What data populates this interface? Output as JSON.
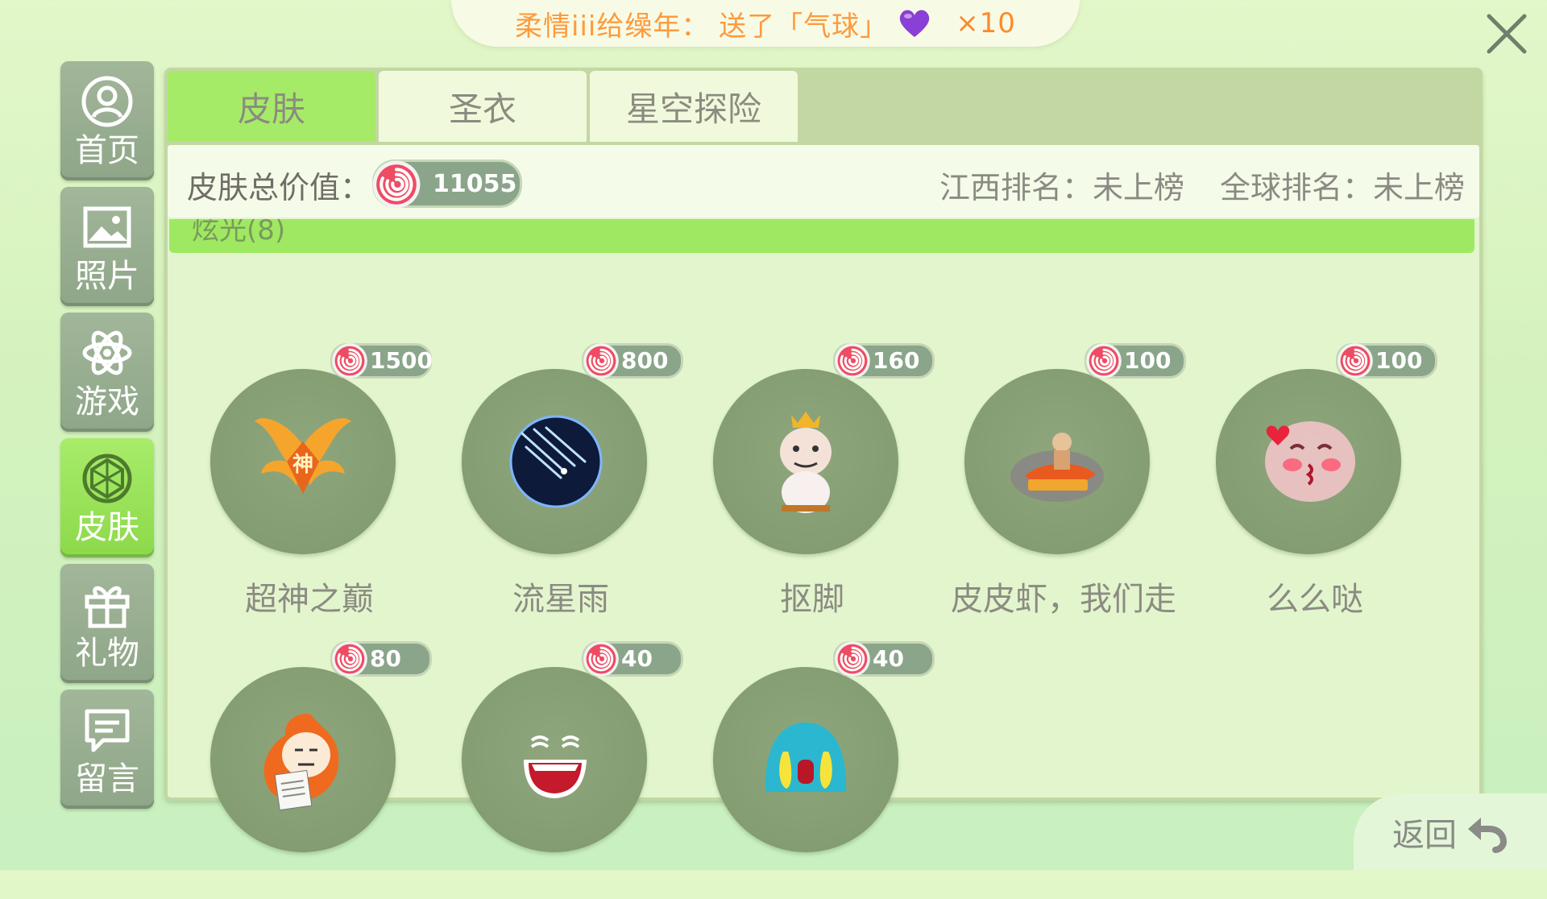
{
  "banner": {
    "text": "柔情iii给缲年：  送了「气球」",
    "count": "×10"
  },
  "sidebar": {
    "items": [
      {
        "label": "首页",
        "icon": "home-user-icon"
      },
      {
        "label": "照片",
        "icon": "photo-icon"
      },
      {
        "label": "游戏",
        "icon": "atom-icon"
      },
      {
        "label": "皮肤",
        "icon": "gem-icon"
      },
      {
        "label": "礼物",
        "icon": "gift-icon"
      },
      {
        "label": "留言",
        "icon": "message-icon"
      }
    ],
    "active_index": 3
  },
  "tabs": [
    "皮肤",
    "圣衣",
    "星空探险"
  ],
  "summary": {
    "total_label": "皮肤总价值：",
    "total_value": "11055",
    "rank_province": "江西排名：未上榜",
    "rank_global": "全球排名：未上榜"
  },
  "category": "炫光(8)",
  "items": [
    {
      "name": "超神之巅",
      "price": "1500"
    },
    {
      "name": "流星雨",
      "price": "800"
    },
    {
      "name": "抠脚",
      "price": "160"
    },
    {
      "name": "皮皮虾，我们走",
      "price": "100"
    },
    {
      "name": "么么哒",
      "price": "100"
    },
    {
      "name": "",
      "price": "80"
    },
    {
      "name": "",
      "price": "40"
    },
    {
      "name": "",
      "price": "40"
    }
  ],
  "back_label": "返回",
  "colors": {
    "accent_green": "#a6eb68",
    "panel": "#c3d7a3",
    "coin": "#e8455a"
  }
}
